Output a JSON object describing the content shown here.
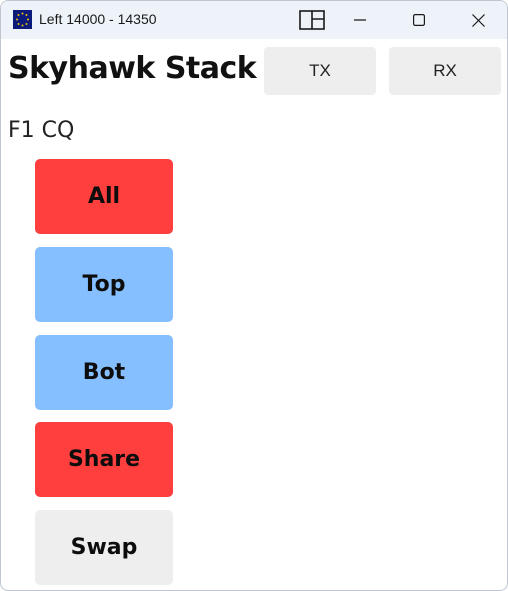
{
  "window": {
    "title": "Left 14000 - 14350"
  },
  "icons": {
    "app": "app-star-icon",
    "snap": "snap-layout-icon",
    "minimize": "minimize-icon",
    "maximize": "maximize-icon",
    "close": "close-icon"
  },
  "header": {
    "title": "Skyhawk Stack",
    "tx_label": "TX",
    "rx_label": "RX"
  },
  "mode": {
    "label": "F1 CQ"
  },
  "buttons": [
    {
      "label": "All",
      "color": "#ff3e3e"
    },
    {
      "label": "Top",
      "color": "#86bfff"
    },
    {
      "label": "Bot",
      "color": "#86bfff"
    },
    {
      "label": "Share",
      "color": "#ff3e3e"
    },
    {
      "label": "Swap",
      "color": "#eeeeee"
    }
  ]
}
